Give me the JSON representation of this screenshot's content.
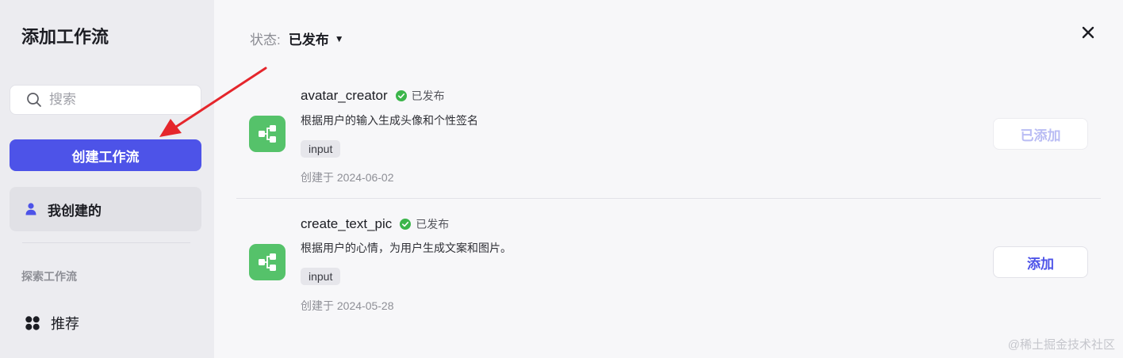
{
  "sidebar": {
    "title": "添加工作流",
    "search_placeholder": "搜索",
    "create_button": "创建工作流",
    "mine_label": "我创建的",
    "section_label": "探索工作流",
    "recommend_label": "推荐",
    "accent_color": "#4d53e8"
  },
  "header": {
    "status_key": "状态:",
    "status_value": "已发布",
    "close_icon": "close-icon"
  },
  "workflows": [
    {
      "name": "avatar_creator",
      "status": "已发布",
      "description": "根据用户的输入生成头像和个性签名",
      "tag": "input",
      "created": "创建于 2024-06-02",
      "action": "已添加"
    },
    {
      "name": "create_text_pic",
      "status": "已发布",
      "description": "根据用户的心情，为用户生成文案和图片。",
      "tag": "input",
      "created": "创建于 2024-05-28",
      "action": "添加"
    }
  ],
  "watermark": "@稀土掘金技术社区",
  "colors": {
    "workflow_icon_bg": "#55c26a",
    "published_check": "#3bb54a",
    "annotation_arrow": "#e5262c"
  }
}
